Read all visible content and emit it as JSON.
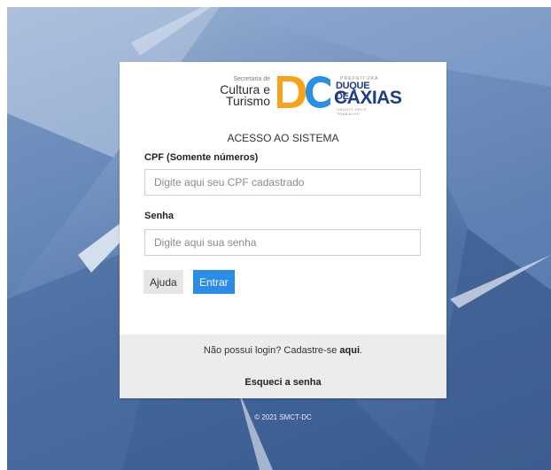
{
  "header": {
    "secretaria_small": "Secretaria de",
    "secretaria_line1": "Cultura e",
    "secretaria_line2": "Turismo",
    "pref_small": "PREFEITURA",
    "pref_duque": "DUQUE DE",
    "pref_caxias": "CAXIAS",
    "pref_tag": "UNIDOS PELO TRABALHO"
  },
  "form": {
    "title": "ACESSO AO SISTEMA",
    "cpf_label": "CPF (Somente números)",
    "cpf_placeholder": "Digite aqui seu CPF cadastrado",
    "senha_label": "Senha",
    "senha_placeholder": "Digite aqui sua senha",
    "help_button": "Ajuda",
    "enter_button": "Entrar"
  },
  "footer": {
    "register_text": "Não possui login? Cadastre-se",
    "register_link": "aqui",
    "register_dot": ".",
    "forgot_link": "Esqueci a senha"
  },
  "copyright": "© 2021 SMCT-DC",
  "colors": {
    "primary_button": "#2c8be6",
    "help_button": "#e6e6e6",
    "footer_bg": "#ececec",
    "dc_blue": "#1e3a8a",
    "dc_orange": "#f7a21b"
  }
}
